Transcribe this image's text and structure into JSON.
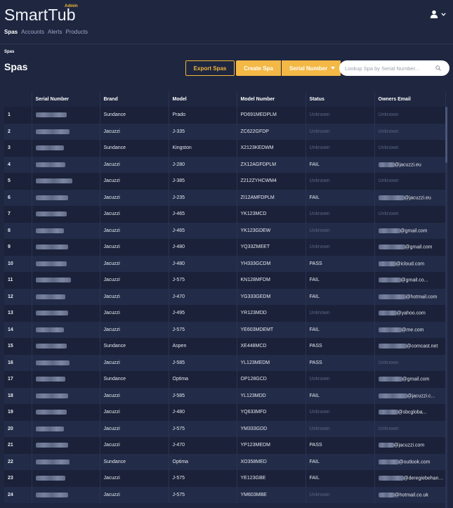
{
  "app": {
    "title": "SmartTub",
    "badge": "Admin"
  },
  "nav": {
    "items": [
      "Spas",
      "Accounts",
      "Alerts",
      "Products"
    ],
    "active": "Spas"
  },
  "breadcrumb": "Spas",
  "page": {
    "title": "Spas"
  },
  "toolbar": {
    "export_label": "Export Spas",
    "create_label": "Create Spa",
    "search_field_label": "Serial Number",
    "search_placeholder": "Lookup Spa by Serial Number..."
  },
  "icons": {
    "user": "user-icon",
    "dropdown": "chevron-down-icon",
    "search": "search-icon"
  },
  "colors": {
    "accent": "#f3b845",
    "background": "#1e2640",
    "unknown_text": "#5b6785"
  },
  "table": {
    "columns": [
      "",
      "Serial Number",
      "Brand",
      "Model",
      "Model Number",
      "Status",
      "Owners Email"
    ],
    "rows": [
      {
        "n": "1",
        "brand": "Sundance",
        "model": "Prado",
        "model_number": "PD691MEDPLM",
        "status": "Unknown",
        "email": "Unknown"
      },
      {
        "n": "2",
        "brand": "Jacuzzi",
        "model": "J-335",
        "model_number": "ZC622GFDP",
        "status": "Unknown",
        "email": "Unknown"
      },
      {
        "n": "3",
        "brand": "Sundance",
        "model": "Kingston",
        "model_number": "X2123KEDWM",
        "status": "Unknown",
        "email": "Unknown"
      },
      {
        "n": "4",
        "brand": "Jacuzzi",
        "model": "J-280",
        "model_number": "ZX12AGFDPLM",
        "status": "FAIL",
        "email": "@jacuzzi.eu"
      },
      {
        "n": "5",
        "brand": "Jacuzzi",
        "model": "J-385",
        "model_number": "Z212ZYHCWM4",
        "status": "Unknown",
        "email": "Unknown"
      },
      {
        "n": "6",
        "brand": "Jacuzzi",
        "model": "J-235",
        "model_number": "ZI12AMFDPLM",
        "status": "FAIL",
        "email": "@jacuzzi.eu"
      },
      {
        "n": "7",
        "brand": "Jacuzzi",
        "model": "J-465",
        "model_number": "YK123MCD",
        "status": "Unknown",
        "email": "Unknown"
      },
      {
        "n": "8",
        "brand": "Jacuzzi",
        "model": "J-465",
        "model_number": "YK123GDEW",
        "status": "Unknown",
        "email": "@gmail.com"
      },
      {
        "n": "9",
        "brand": "Jacuzzi",
        "model": "J-480",
        "model_number": "YQ33ZMEET",
        "status": "Unknown",
        "email": "@gmail.com"
      },
      {
        "n": "10",
        "brand": "Jacuzzi",
        "model": "J-480",
        "model_number": "YH333GCDM",
        "status": "PASS",
        "email": "@icloud.com"
      },
      {
        "n": "11",
        "brand": "Jacuzzi",
        "model": "J-575",
        "model_number": "KN128MFDM",
        "status": "FAIL",
        "email": "@gmail.co..."
      },
      {
        "n": "12",
        "brand": "Jacuzzi",
        "model": "J-470",
        "model_number": "YG333GEDM",
        "status": "FAIL",
        "email": "@hotmail.com"
      },
      {
        "n": "13",
        "brand": "Jacuzzi",
        "model": "J-495",
        "model_number": "YR123MDD",
        "status": "Unknown",
        "email": "@yahoo.com"
      },
      {
        "n": "14",
        "brand": "Jacuzzi",
        "model": "J-575",
        "model_number": "YE603MDEMT",
        "status": "FAIL",
        "email": "@me.com"
      },
      {
        "n": "15",
        "brand": "Sundance",
        "model": "Aspen",
        "model_number": "XE448MCD",
        "status": "PASS",
        "email": "@comcast.net"
      },
      {
        "n": "16",
        "brand": "Jacuzzi",
        "model": "J-585",
        "model_number": "YL123MEDM",
        "status": "PASS",
        "email": "Unknown"
      },
      {
        "n": "17",
        "brand": "Sundance",
        "model": "Optima",
        "model_number": "OP128GCD",
        "status": "Unknown",
        "email": "@gmail.com"
      },
      {
        "n": "18",
        "brand": "Jacuzzi",
        "model": "J-585",
        "model_number": "YL123MDD",
        "status": "FAIL",
        "email": "@jacuzzi.c..."
      },
      {
        "n": "19",
        "brand": "Jacuzzi",
        "model": "J-480",
        "model_number": "YQ633MFD",
        "status": "Unknown",
        "email": "@sbcgloba..."
      },
      {
        "n": "20",
        "brand": "Jacuzzi",
        "model": "J-575",
        "model_number": "YM333GDD",
        "status": "Unknown",
        "email": "Unknown"
      },
      {
        "n": "21",
        "brand": "Jacuzzi",
        "model": "J-470",
        "model_number": "YP123MEDM",
        "status": "PASS",
        "email": "@jacuzzi.com"
      },
      {
        "n": "22",
        "brand": "Sundance",
        "model": "Optima",
        "model_number": "XO358MED",
        "status": "FAIL",
        "email": "@outlook.com"
      },
      {
        "n": "23",
        "brand": "Jacuzzi",
        "model": "J-575",
        "model_number": "YE123GBE",
        "status": "FAIL",
        "email": "@deregiebehand..."
      },
      {
        "n": "24",
        "brand": "Jacuzzi",
        "model": "J-575",
        "model_number": "YM603MBE",
        "status": "Unknown",
        "email": "@hotmail.co.uk"
      }
    ]
  }
}
